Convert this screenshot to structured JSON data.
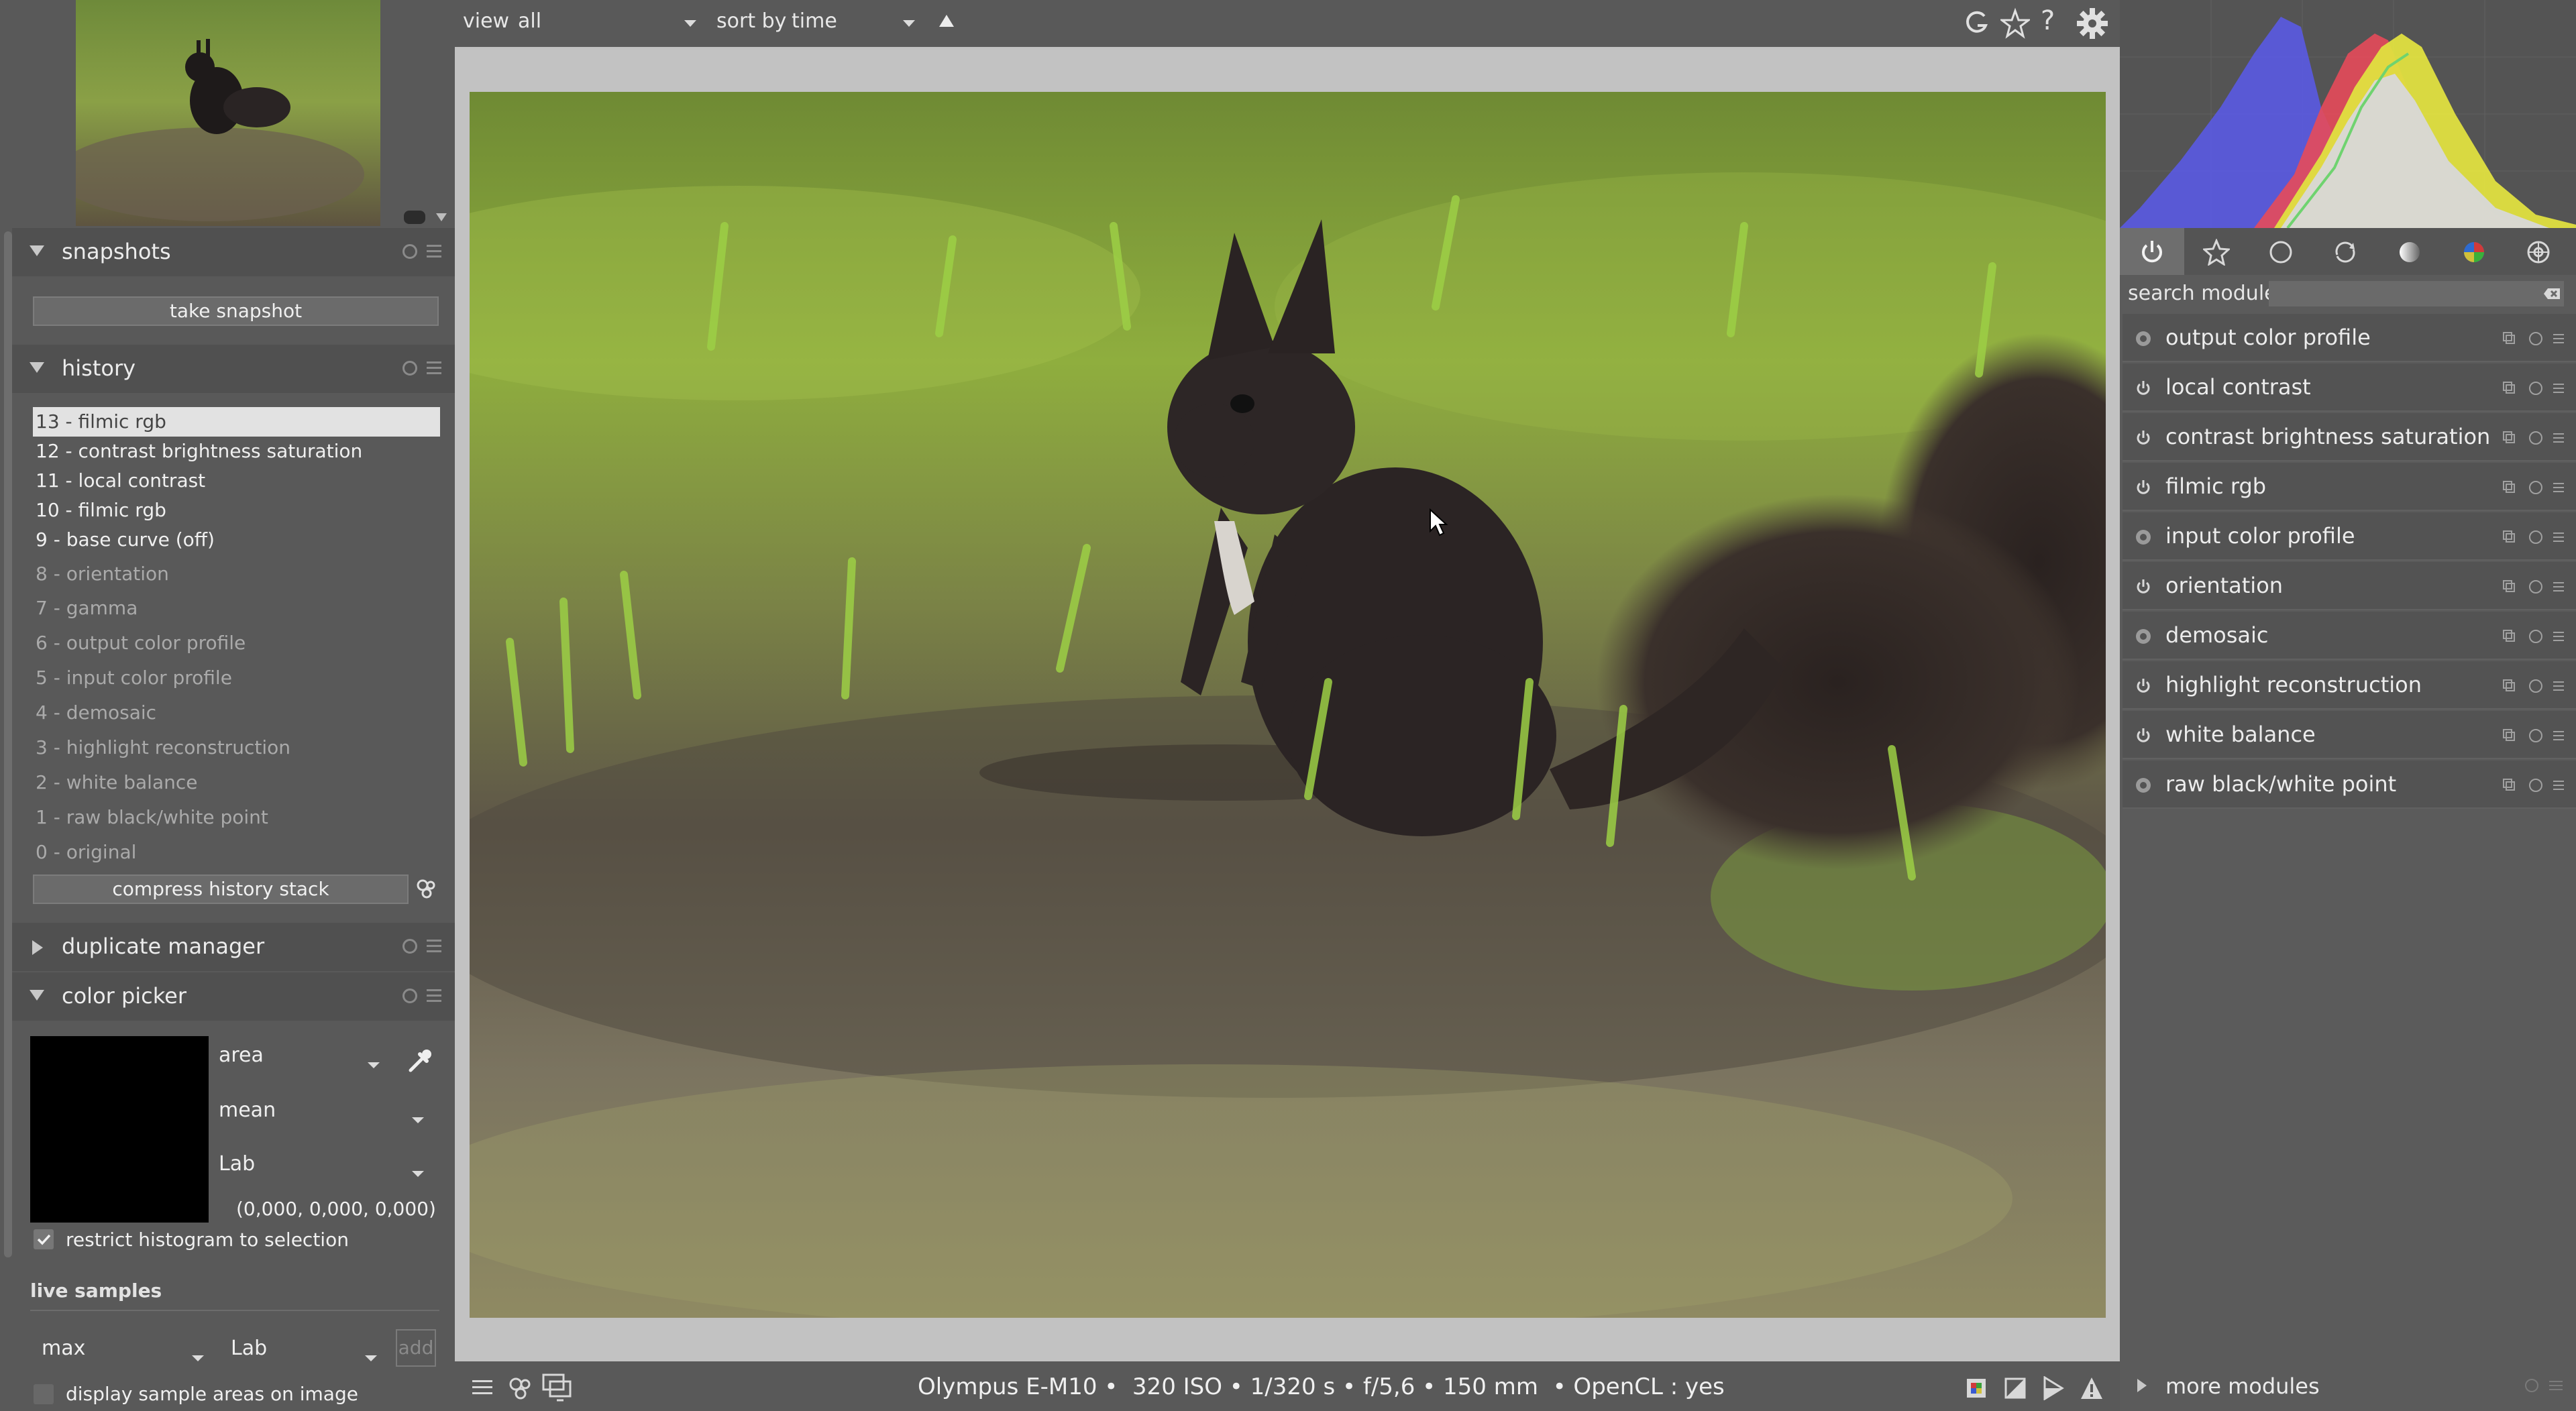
{
  "topbar": {
    "view_label": "view",
    "view_value": "all",
    "sort_label": "sort by",
    "sort_value": "time"
  },
  "left": {
    "snapshots": {
      "title": "snapshots",
      "button": "take snapshot"
    },
    "history": {
      "title": "history",
      "items": [
        "13 - filmic rgb",
        "12 - contrast brightness saturation",
        "11 - local contrast",
        "10 - filmic rgb",
        "9 - base curve (off)",
        "8 - orientation",
        "7 - gamma",
        "6 - output color profile",
        "5 - input color profile",
        "4 - demosaic",
        "3 - highlight reconstruction",
        "2 - white balance",
        "1 - raw black/white point",
        "0 - original"
      ],
      "compress_button": "compress history stack"
    },
    "duplicate_manager": {
      "title": "duplicate manager"
    },
    "color_picker": {
      "title": "color picker",
      "mode": "area",
      "statistic": "mean",
      "color_space": "Lab",
      "value": "(0,000, 0,000, 0,000)",
      "restrict_label": "restrict histogram to selection",
      "live_samples_title": "live samples",
      "sample_stat": "max",
      "sample_space": "Lab",
      "add_label": "add",
      "display_label": "display sample areas on image"
    }
  },
  "bottom": {
    "exif": "Olympus E-M10 •  320 ISO • 1/320 s • f/5,6 • 150 mm  • OpenCL : yes"
  },
  "right": {
    "search_label": "search module",
    "search_value": "",
    "modules": [
      "output color profile",
      "local contrast",
      "contrast brightness saturation",
      "filmic rgb",
      "input color profile",
      "orientation",
      "demosaic",
      "highlight reconstruction",
      "white balance",
      "raw black/white point"
    ],
    "more_modules": "more modules"
  }
}
